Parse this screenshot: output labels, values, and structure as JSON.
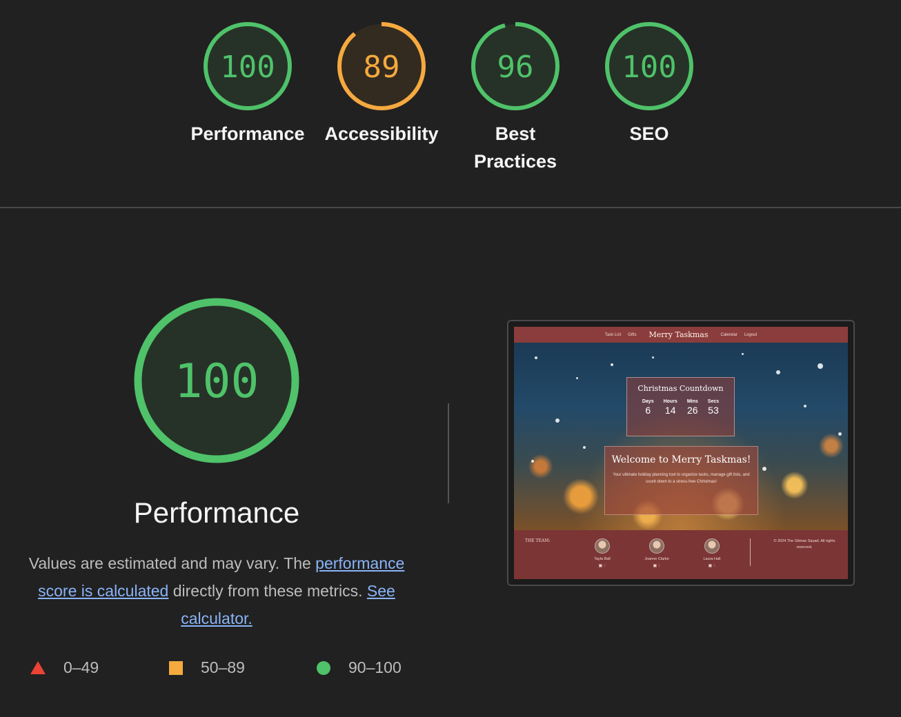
{
  "categories": [
    {
      "label": "Performance",
      "score": "100",
      "fraction": 1.0,
      "status": "pass"
    },
    {
      "label": "Accessibility",
      "score": "89",
      "fraction": 0.89,
      "status": "average"
    },
    {
      "label": "Best Practices",
      "score": "96",
      "fraction": 0.96,
      "status": "pass"
    },
    {
      "label": "SEO",
      "score": "100",
      "fraction": 1.0,
      "status": "pass"
    }
  ],
  "colors": {
    "pass": "#4fc26a",
    "average": "#f5a93f",
    "fail": "#eb4335"
  },
  "main": {
    "score": "100",
    "fraction": 1.0,
    "title": "Performance",
    "desc_prefix": "Values are estimated and may vary. The ",
    "link1": "performance score is calculated",
    "desc_middle": " directly from these metrics. ",
    "link2": "See calculator."
  },
  "legend": [
    {
      "icon": "triangle-icon",
      "range": "0–49"
    },
    {
      "icon": "square-icon",
      "range": "50–89"
    },
    {
      "icon": "circle-icon",
      "range": "90–100"
    }
  ],
  "screenshot": {
    "nav": [
      "Task List",
      "Gifts",
      "Merry Taskmas",
      "Calendar",
      "Logout"
    ],
    "countdown": {
      "title": "Christmas Countdown",
      "units": [
        {
          "label": "Days",
          "value": "6"
        },
        {
          "label": "Hours",
          "value": "14"
        },
        {
          "label": "Mins",
          "value": "26"
        },
        {
          "label": "Secs",
          "value": "53"
        }
      ]
    },
    "welcome": {
      "title": "Welcome to Merry Taskmas!",
      "desc": "Your ultimate holiday planning tool to organize tasks, manage gift lists, and count down to a stress-free Christmas!"
    },
    "footer": {
      "team_label": "THE TEAM:",
      "members": [
        "Tayla Ball",
        "Joanne Clarke",
        "Laura Hall"
      ],
      "copyright": "© 2024 The Gitmas Squad. All rights reserved."
    }
  }
}
